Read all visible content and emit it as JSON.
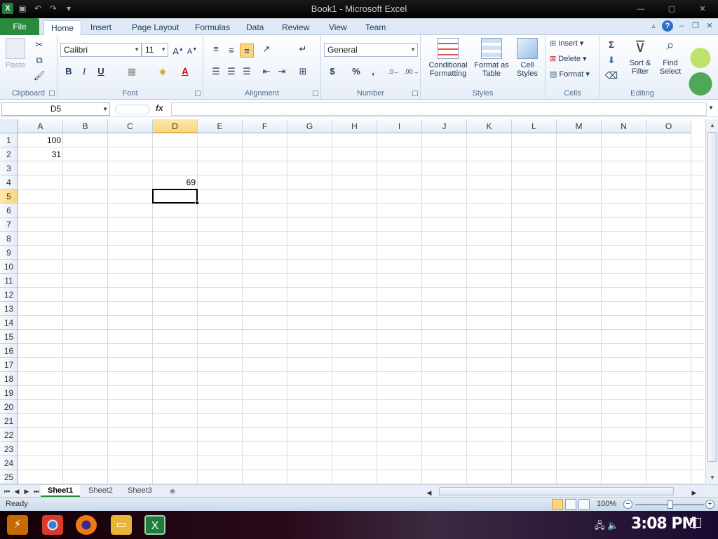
{
  "window": {
    "title": "Book1 - Microsoft Excel",
    "app_glyph": "X"
  },
  "ribbon_tabs": [
    "File",
    "Home",
    "Insert",
    "Page Layout",
    "Formulas",
    "Data",
    "Review",
    "View",
    "Team"
  ],
  "ribbon": {
    "clipboard": {
      "label": "Clipboard",
      "paste": "Paste"
    },
    "font": {
      "label": "Font",
      "family": "Calibri",
      "size": "11",
      "bold": "B",
      "italic": "I",
      "underline": "U"
    },
    "alignment": {
      "label": "Alignment"
    },
    "number": {
      "label": "Number",
      "format": "General",
      "currency": "$",
      "percent": "%",
      "comma": ","
    },
    "styles": {
      "label": "Styles",
      "conditional": "Conditional",
      "conditional2": "Formatting",
      "table": "Format as",
      "table2": "Table",
      "cell": "Cell",
      "cell2": "Styles"
    },
    "cells": {
      "label": "Cells",
      "insert": "Insert",
      "delete": "Delete",
      "format": "Format"
    },
    "editing": {
      "label": "Editing",
      "sum": "Σ",
      "sort": "Sort &",
      "sort2": "Filter",
      "find": "Find",
      "find2": "Select"
    }
  },
  "formula_bar": {
    "name_box": "D5",
    "fx": "fx",
    "value": ""
  },
  "columns": [
    "A",
    "B",
    "C",
    "D",
    "E",
    "F",
    "G",
    "H",
    "I",
    "J",
    "K",
    "L",
    "M",
    "N",
    "O"
  ],
  "rows": [
    "1",
    "2",
    "3",
    "4",
    "5",
    "6",
    "7",
    "8",
    "9",
    "10",
    "11",
    "12",
    "13",
    "14",
    "15",
    "16",
    "17",
    "18",
    "19",
    "20",
    "21",
    "22",
    "23",
    "24",
    "25"
  ],
  "cells": {
    "A1": "100",
    "A2": "31",
    "D4": "69"
  },
  "selected_cell": "D5",
  "sheets": [
    "Sheet1",
    "Sheet2",
    "Sheet3"
  ],
  "active_sheet": "Sheet1",
  "status": {
    "mode": "Ready",
    "zoom": "100%"
  },
  "taskbar": {
    "clock": "3:08 PM"
  },
  "colors": {
    "file_tab": "#2a8a3e",
    "selection_header": "#f9d77e",
    "ribbon_bg": "#dfe9f5"
  }
}
